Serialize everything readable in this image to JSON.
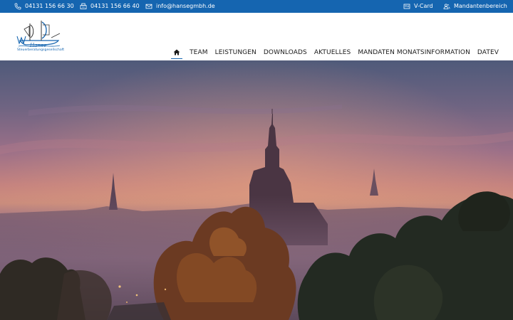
{
  "topbar": {
    "phone": "04131 156 66 30",
    "fax": "04131 156 66 40",
    "email": "info@hansegmbh.de",
    "vcard": "V-Card",
    "client_area": "Mandantenbereich",
    "bg_color": "#1565b0"
  },
  "logo": {
    "word": "Hanse",
    "subtitle": "Steuerberatungsgesellschaft"
  },
  "nav": {
    "home_icon": "home-icon",
    "items": [
      "TEAM",
      "LEISTUNGEN",
      "DOWNLOADS",
      "AKTUELLES",
      "MANDATEN MONATSINFORMATION",
      "DATEV"
    ]
  },
  "hero": {
    "description_icon": "city-skyline-fog-photo"
  }
}
